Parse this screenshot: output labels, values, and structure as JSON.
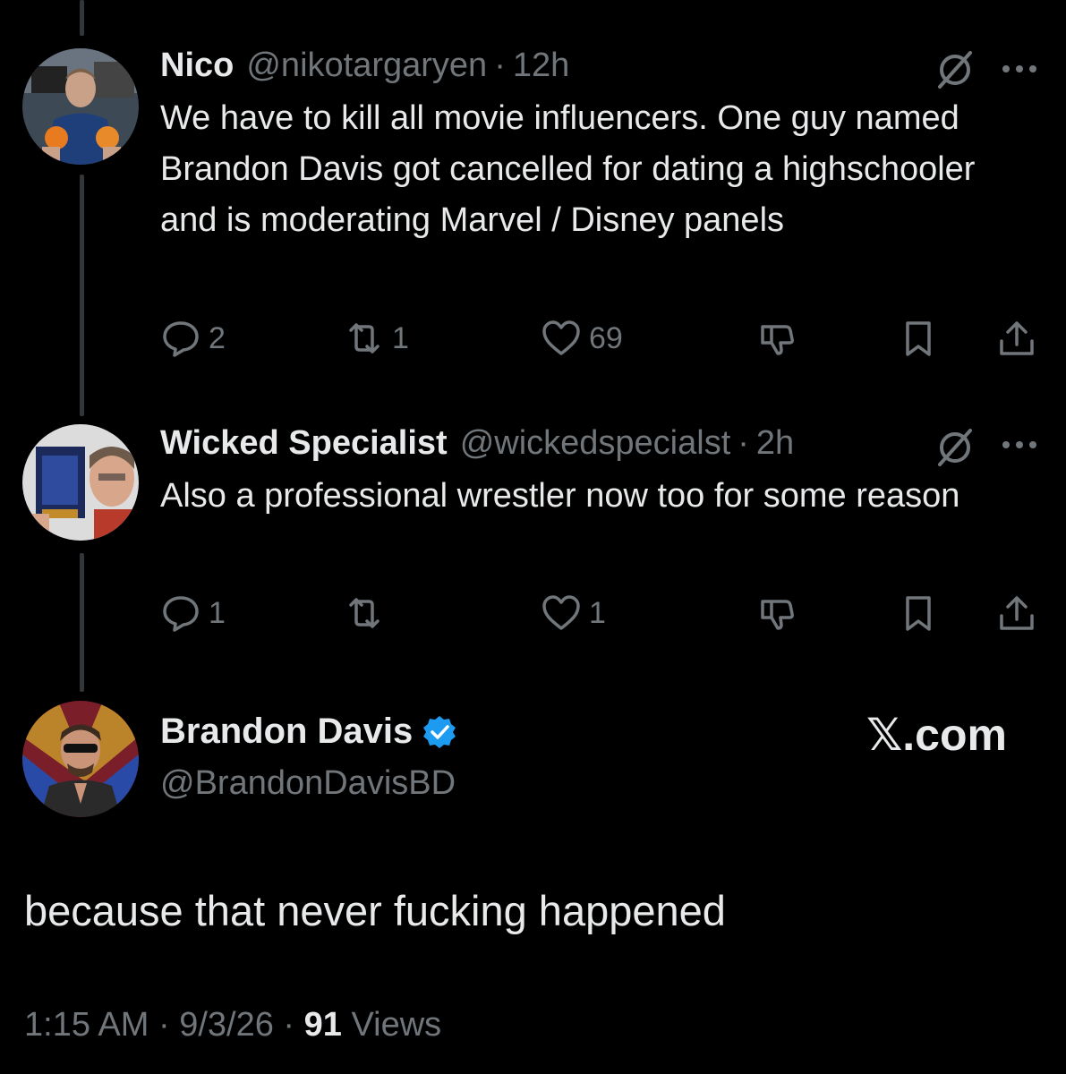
{
  "tweets": [
    {
      "name": "Nico",
      "handle": "@nikotargaryen",
      "separator": "·",
      "time": "12h",
      "text": "We have to kill all movie influencers. One guy named Brandon Davis got cancelled for dating a highschooler and is moderating Marvel / Disney panels",
      "replies": "2",
      "reposts": "1",
      "likes": "69"
    },
    {
      "name": "Wicked Specialist",
      "handle": "@wickedspecialst",
      "separator": "·",
      "time": "2h",
      "text": "Also a professional wrestler now too for some reason",
      "replies": "1",
      "reposts": "",
      "likes": "1"
    }
  ],
  "main": {
    "name": "Brandon Davis",
    "handle": "@BrandonDavisBD",
    "site": "𝕏.com",
    "text": "because that never fucking happened",
    "time": "1:15 AM",
    "date": "9/3/26",
    "separator": "·",
    "views_count": "91",
    "views_label": "Views"
  },
  "colors": {
    "background": "#000000",
    "text": "#e7e9ea",
    "muted": "#71767b",
    "verified": "#1d9bf0",
    "thread_line": "#333639"
  },
  "icons": [
    "grok-icon",
    "more-icon",
    "reply-icon",
    "repost-icon",
    "like-icon",
    "downvote-icon",
    "bookmark-icon",
    "share-icon",
    "verified-badge-icon"
  ]
}
